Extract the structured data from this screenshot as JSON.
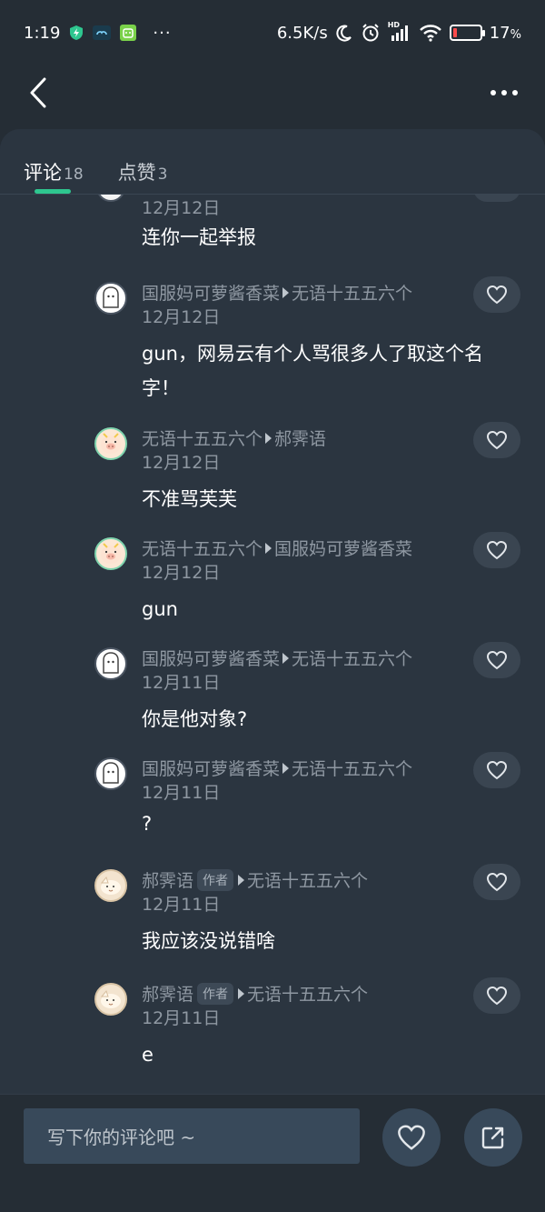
{
  "status_bar": {
    "time": "1:19",
    "extra_dots": "···",
    "net_speed": "6.5K/s",
    "hd_label": "HD",
    "battery_percent": "17",
    "battery_unit": "%",
    "battery_level": 0.17,
    "battery_color": "#ff4b4b"
  },
  "tabs": {
    "comments_label": "评论",
    "comments_count": "18",
    "likes_label": "点赞",
    "likes_count": "3",
    "accent_color": "#2ec68f"
  },
  "partial_comment": {
    "date": "12月12日",
    "text": "连你一起举报"
  },
  "comments": [
    {
      "avatar": "ghost-avatar",
      "from": "国服妈可萝酱香菜",
      "to": "无语十五五六个",
      "date": "12月12日",
      "text": "gun，网易云有个人骂很多人了取这个名字！"
    },
    {
      "avatar": "pig-avatar",
      "from": "无语十五五六个",
      "to": "郝霁语",
      "date": "12月12日",
      "text": "不准骂芙芙"
    },
    {
      "avatar": "pig-avatar",
      "from": "无语十五五六个",
      "to": "国服妈可萝酱香菜",
      "date": "12月12日",
      "text": "gun"
    },
    {
      "avatar": "ghost-avatar",
      "from": "国服妈可萝酱香菜",
      "to": "无语十五五六个",
      "date": "12月11日",
      "text": "你是他对象?"
    },
    {
      "avatar": "ghost-avatar",
      "from": "国服妈可萝酱香菜",
      "to": "无语十五五六个",
      "date": "12月11日",
      "text": "?"
    },
    {
      "avatar": "rabbit-avatar",
      "from": "郝霁语",
      "author_tag": "作者",
      "to": "无语十五五六个",
      "date": "12月11日",
      "text": "我应该没说错啥"
    },
    {
      "avatar": "rabbit-avatar",
      "from": "郝霁语",
      "author_tag": "作者",
      "to": "无语十五五六个",
      "date": "12月11日",
      "text": "e"
    }
  ],
  "bottom_bar": {
    "input_placeholder": "写下你的评论吧 ~"
  }
}
